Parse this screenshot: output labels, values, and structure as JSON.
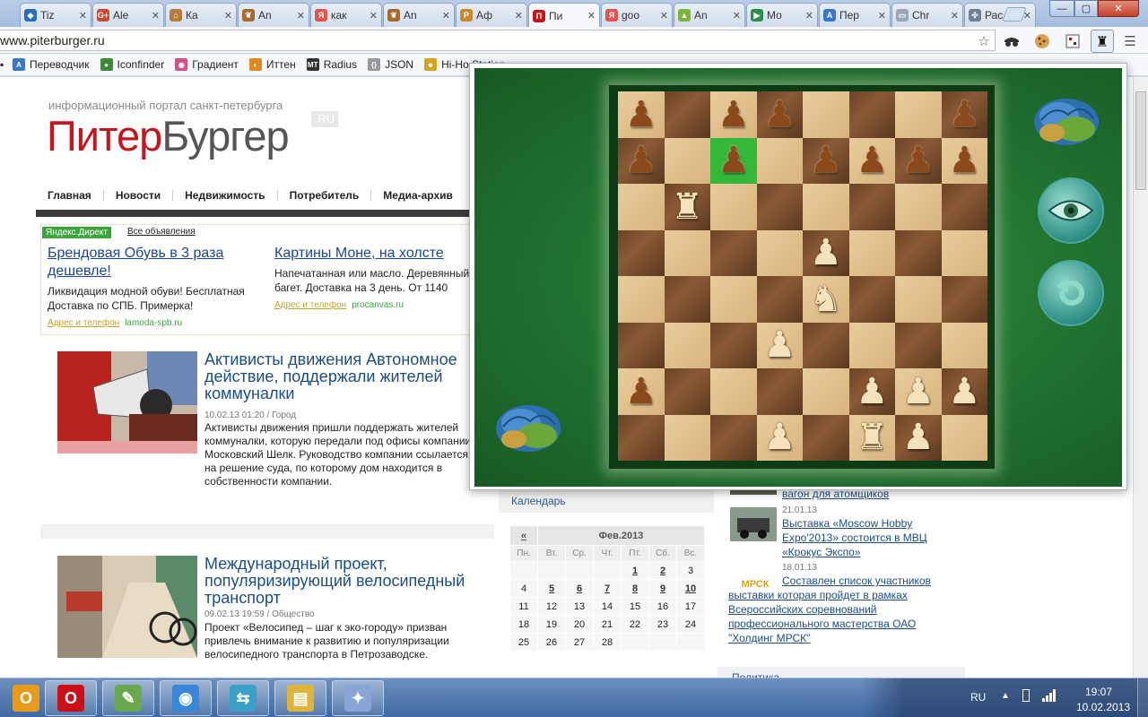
{
  "browser": {
    "tabs": [
      {
        "label": "Tiz",
        "fav_color": "#2a6ebb",
        "fav_glyph": "◆"
      },
      {
        "label": "Ale",
        "fav_color": "#d2452f",
        "fav_glyph": "G+"
      },
      {
        "label": "Ка",
        "fav_color": "#b67a3b",
        "fav_glyph": "⌂"
      },
      {
        "label": "An",
        "fav_color": "#a66a2c",
        "fav_glyph": "❦"
      },
      {
        "label": "как",
        "fav_color": "#e8524c",
        "fav_glyph": "Я"
      },
      {
        "label": "An",
        "fav_color": "#a66a2c",
        "fav_glyph": "❦"
      },
      {
        "label": "Аф",
        "fav_color": "#c98a2d",
        "fav_glyph": "P"
      },
      {
        "label": "Пи",
        "fav_color": "#c4161c",
        "fav_glyph": "П"
      },
      {
        "label": "goo",
        "fav_color": "#e8524c",
        "fav_glyph": "Я"
      },
      {
        "label": "An",
        "fav_color": "#7db23b",
        "fav_glyph": "▲"
      },
      {
        "label": "Мо",
        "fav_color": "#2d8e4a",
        "fav_glyph": "▶"
      },
      {
        "label": "Пер",
        "fav_color": "#3a77c8",
        "fav_glyph": "A"
      },
      {
        "label": "Chr",
        "fav_color": "#9aa7b8",
        "fav_glyph": "▭"
      },
      {
        "label": "Рас",
        "fav_color": "#6f7f96",
        "fav_glyph": "✣"
      }
    ],
    "active_tab_index": 7,
    "url": "www.piterburger.ru",
    "window_controls": {
      "minimize": "—",
      "maximize": "▢",
      "close": "✕"
    },
    "bookmarks": [
      {
        "label": "Переводчик",
        "color": "#3a77c8",
        "glyph": "A"
      },
      {
        "label": "Iconfinder",
        "color": "#3d8a3a",
        "glyph": "●"
      },
      {
        "label": "Градиент",
        "color": "#d84d8a",
        "glyph": "◉"
      },
      {
        "label": "Иттен",
        "color": "#e08a1c",
        "glyph": "◐"
      },
      {
        "label": "Radius",
        "color": "#333333",
        "glyph": "MT"
      },
      {
        "label": "JSON",
        "color": "#999999",
        "glyph": "{}"
      },
      {
        "label": "Hi-Ho Station",
        "color": "#d9a21c",
        "glyph": "☻"
      }
    ]
  },
  "site": {
    "tagline": "информационный портал санкт-петербурга",
    "logo_part1": "Питер",
    "logo_part2": "Бургер",
    "logo_suffix": ".RU",
    "nav": [
      "Главная",
      "Новости",
      "Недвижимость",
      "Потребитель",
      "Медиа-архив"
    ],
    "direct_badge": "Яндекс.Директ",
    "direct_all": "Все объявления",
    "ads": [
      {
        "title": "Брендовая Обувь в 3 раза дешевле!",
        "text": "Ликвидация модной обуви! Бесплатная Доставка по СПБ. Примерка!",
        "contact": "Адрес и телефон",
        "domain": "lamoda-spb.ru"
      },
      {
        "title": "Картины Моне, на холсте",
        "text": "Напечатанная или масло. Деревянный багет. Доставка на 3 день. От 1140",
        "contact": "Адрес и телефон",
        "domain": "procanvas.ru"
      }
    ],
    "news": [
      {
        "title": "Активисты движения Автономное действие, поддержали жителей коммуналки",
        "meta": "10.02.13 01:20 / Город",
        "text": "Активисты движения пришли поддержать жителей коммуналки, которую передали под офисы компании Московский Шелк. Руководство компании ссылается на решение суда, по которому дом находится в собственности компании."
      },
      {
        "title": "Международный проект, популяризирующий велосипедный транспорт",
        "meta": "09.02.13 19:59 / Общество",
        "text": "Проект «Велосипед – шаг к эко-городу» призван привлечь внимание к развитию и популяризации велосипедного транспорта в Петрозаводске."
      }
    ],
    "calendar": {
      "heading": "Календарь",
      "prev": "«",
      "month": "Фев.2013",
      "weekdays": [
        "Пн.",
        "Вт.",
        "Ср.",
        "Чт.",
        "Пт.",
        "Сб.",
        "Вс."
      ],
      "weeks": [
        [
          "",
          "",
          "",
          "",
          "1",
          "2",
          "3"
        ],
        [
          "4",
          "5",
          "6",
          "7",
          "8",
          "9",
          "10"
        ],
        [
          "11",
          "12",
          "13",
          "14",
          "15",
          "16",
          "17"
        ],
        [
          "18",
          "19",
          "20",
          "21",
          "22",
          "23",
          "24"
        ],
        [
          "25",
          "26",
          "27",
          "28",
          "",
          "",
          ""
        ]
      ],
      "linked_days": [
        "1",
        "2",
        "5",
        "6",
        "7",
        "8",
        "9",
        "10"
      ]
    },
    "right_news": [
      {
        "title": "вагон для атомщиков",
        "date": ""
      },
      {
        "title": "Выставка «Moscow Hobby Expo'2013» состоится в МВЦ «Крокус Экспо»",
        "date": "21.01.13"
      },
      {
        "title": "Составлен список участников выставки которая пройдет в рамках Всероссийских соревнований профессионального мастерства ОАО \"Холдинг МРСК\"",
        "date": "18.01.13",
        "thumb_text": "МРСК"
      }
    ],
    "right_footer": "Политика"
  },
  "chess": {
    "board": [
      [
        "bp",
        "",
        "bp",
        "bp",
        "",
        "",
        "",
        "bp"
      ],
      [
        "bp",
        "",
        "bp",
        "",
        "bp",
        "bp",
        "bp",
        "bp"
      ],
      [
        "",
        "wr",
        "",
        "",
        "",
        "",
        "",
        ""
      ],
      [
        "",
        "",
        "",
        "",
        "wp",
        "",
        "",
        ""
      ],
      [
        "",
        "",
        "",
        "",
        "wn",
        "",
        "",
        ""
      ],
      [
        "",
        "",
        "",
        "wp",
        "",
        "",
        "",
        ""
      ],
      [
        "bp",
        "",
        "",
        "",
        "",
        "wp",
        "wp",
        "wp"
      ],
      [
        "",
        "",
        "",
        "wp",
        "",
        "wr",
        "wp",
        ""
      ]
    ],
    "highlight": [
      1,
      2
    ],
    "buttons": {
      "view": "eye-icon",
      "undo": "undo-icon"
    },
    "colors": {
      "felt": "#1f6e2e",
      "highlight": "#35b83a",
      "button": "#2f8f86"
    }
  },
  "taskbar": {
    "apps": [
      {
        "name": "outlook",
        "glyph": "O",
        "color": "#e89a1c"
      },
      {
        "name": "opera",
        "glyph": "O",
        "color": "#cc0f16"
      },
      {
        "name": "editor",
        "glyph": "✎",
        "color": "#6aa84f"
      },
      {
        "name": "chrome",
        "glyph": "◉",
        "color": "#3a86d9"
      },
      {
        "name": "network",
        "glyph": "⇆",
        "color": "#3aa0c8"
      },
      {
        "name": "explorer",
        "glyph": "▤",
        "color": "#e0b43a"
      },
      {
        "name": "paint",
        "glyph": "✦",
        "color": "#8aa4d6"
      }
    ],
    "lang": "RU",
    "time": "19:07",
    "date": "10.02.2013"
  }
}
